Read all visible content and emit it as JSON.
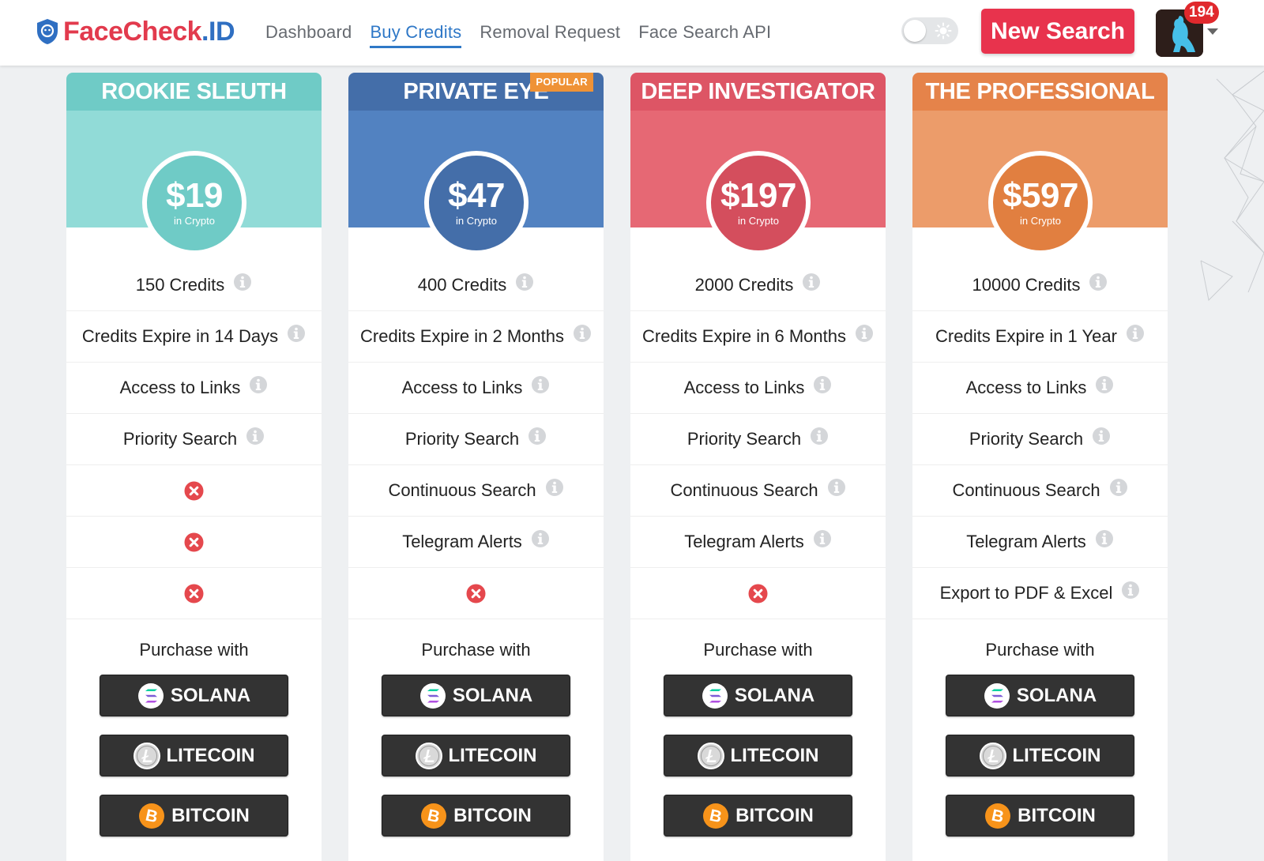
{
  "header": {
    "logo_part1": "FaceCheck",
    "logo_part2": ".ID",
    "nav": [
      "Dashboard",
      "Buy Credits",
      "Removal Request",
      "Face Search API"
    ],
    "active_nav": "Buy Credits",
    "new_search_label": "New Search",
    "notification_count": "194"
  },
  "purchase_label": "Purchase with",
  "payment_methods": [
    "SOLANA",
    "LITECOIN",
    "BITCOIN"
  ],
  "plans": [
    {
      "title": "ROOKIE SLEUTH",
      "price": "$19",
      "price_sub": "in Crypto",
      "badge": "",
      "colors": {
        "header": "#6fcbc6",
        "band": "#91dbd7",
        "circle": "#6fcbc6"
      },
      "features": [
        "150 Credits",
        "Credits Expire in 14 Days",
        "Access to Links",
        "Priority Search",
        null,
        null,
        null
      ]
    },
    {
      "title": "PRIVATE EYE",
      "price": "$47",
      "price_sub": "in Crypto",
      "badge": "POPULAR",
      "colors": {
        "header": "#446ea9",
        "band": "#5282c1",
        "circle": "#446ea9"
      },
      "features": [
        "400 Credits",
        "Credits Expire in 2 Months",
        "Access to Links",
        "Priority Search",
        "Continuous Search",
        "Telegram Alerts",
        null
      ]
    },
    {
      "title": "DEEP INVESTIGATOR",
      "price": "$197",
      "price_sub": "in Crypto",
      "badge": "",
      "colors": {
        "header": "#dd5565",
        "band": "#e66874",
        "circle": "#d44e5d"
      },
      "features": [
        "2000 Credits",
        "Credits Expire in 6 Months",
        "Access to Links",
        "Priority Search",
        "Continuous Search",
        "Telegram Alerts",
        null
      ]
    },
    {
      "title": "THE PROFESSIONAL",
      "price": "$597",
      "price_sub": "in Crypto",
      "badge": "",
      "colors": {
        "header": "#e5834a",
        "band": "#ec9c6a",
        "circle": "#e17f40"
      },
      "features": [
        "10000 Credits",
        "Credits Expire in 1 Year",
        "Access to Links",
        "Priority Search",
        "Continuous Search",
        "Telegram Alerts",
        "Export to PDF & Excel"
      ]
    }
  ],
  "icons": {
    "info": "info-circle-icon",
    "unavailable": "x-circle-icon",
    "unavailable_color": "#e5484d"
  }
}
